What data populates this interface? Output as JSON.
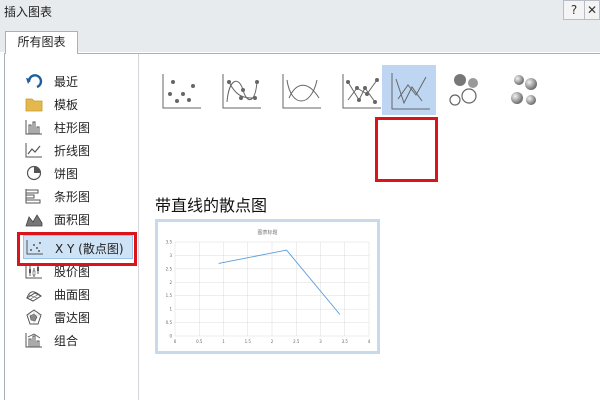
{
  "window": {
    "title": "插入图表",
    "help_label": "?",
    "close_label": "✕"
  },
  "tabs": [
    {
      "label": "所有图表"
    }
  ],
  "nav": {
    "items": [
      {
        "label": "最近",
        "icon": "undo-arrow-icon"
      },
      {
        "label": "模板",
        "icon": "folder-icon"
      },
      {
        "label": "柱形图",
        "icon": "column-chart-icon"
      },
      {
        "label": "折线图",
        "icon": "line-chart-icon"
      },
      {
        "label": "饼图",
        "icon": "pie-chart-icon"
      },
      {
        "label": "条形图",
        "icon": "bar-chart-icon"
      },
      {
        "label": "面积图",
        "icon": "area-chart-icon"
      },
      {
        "label": "X Y (散点图)",
        "icon": "scatter-chart-icon"
      },
      {
        "label": "股价图",
        "icon": "stock-chart-icon"
      },
      {
        "label": "曲面图",
        "icon": "surface-chart-icon"
      },
      {
        "label": "雷达图",
        "icon": "radar-chart-icon"
      },
      {
        "label": "组合",
        "icon": "combo-chart-icon"
      }
    ],
    "selected_index": 7
  },
  "subtypes": {
    "items": [
      {
        "icon": "scatter-icon"
      },
      {
        "icon": "scatter-smooth-lines-markers-icon"
      },
      {
        "icon": "scatter-smooth-lines-icon"
      },
      {
        "icon": "scatter-straight-lines-markers-icon"
      },
      {
        "icon": "scatter-straight-lines-icon"
      },
      {
        "icon": "bubble-icon"
      },
      {
        "icon": "3d-bubble-icon"
      }
    ],
    "selected_index": 4
  },
  "selected_title": "带直线的散点图",
  "chart_data": {
    "type": "line",
    "title": "图表标题",
    "x": [
      0.9,
      2.3,
      3.4
    ],
    "y": [
      2.7,
      3.2,
      0.8
    ],
    "xlim": [
      0,
      4
    ],
    "ylim": [
      0,
      3.5
    ],
    "xticks": [
      "0",
      "0.5",
      "1",
      "1.5",
      "2",
      "2.5",
      "3",
      "3.5",
      "4"
    ],
    "yticks": [
      "0",
      "0.5",
      "1",
      "1.5",
      "2",
      "2.5",
      "3",
      "3.5"
    ],
    "line_color": "#5b9bd5",
    "grid": true
  },
  "colors": {
    "highlight": "#d9141b",
    "selection": "#bed6f1"
  }
}
